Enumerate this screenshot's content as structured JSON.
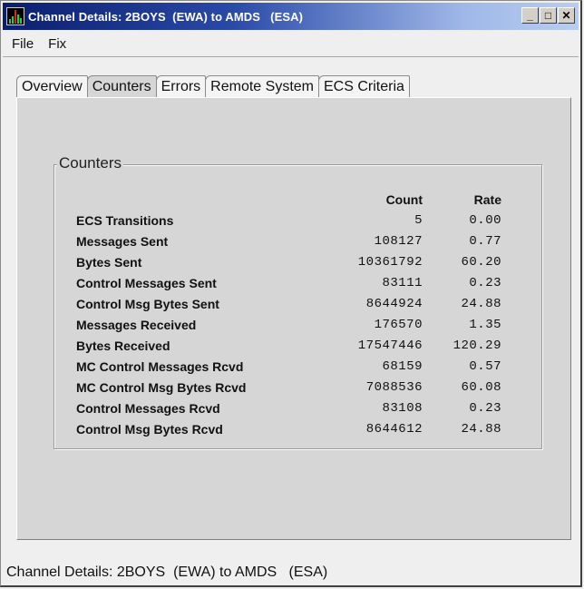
{
  "window": {
    "title": "Channel Details: 2BOYS  (EWA) to AMDS   (ESA)",
    "app_icon": "bar-graph-icon",
    "controls": {
      "minimize": "_",
      "maximize": "□",
      "close": "✕"
    }
  },
  "menubar": {
    "items": [
      {
        "label": "File"
      },
      {
        "label": "Fix"
      }
    ]
  },
  "tabs": [
    {
      "label": "Overview",
      "active": false
    },
    {
      "label": "Counters",
      "active": true
    },
    {
      "label": "Errors",
      "active": false
    },
    {
      "label": "Remote System",
      "active": false
    },
    {
      "label": "ECS Criteria",
      "active": false
    }
  ],
  "counters": {
    "group_title": "Counters",
    "headers": {
      "count": "Count",
      "rate": "Rate"
    },
    "rows": [
      {
        "label": "ECS Transitions",
        "count": "5",
        "rate": "0.00"
      },
      {
        "label": "Messages Sent",
        "count": "108127",
        "rate": "0.77"
      },
      {
        "label": "Bytes Sent",
        "count": "10361792",
        "rate": "60.20"
      },
      {
        "label": "Control Messages Sent",
        "count": "83111",
        "rate": "0.23"
      },
      {
        "label": "Control Msg Bytes Sent",
        "count": "8644924",
        "rate": "24.88"
      },
      {
        "label": "Messages Received",
        "count": "176570",
        "rate": "1.35"
      },
      {
        "label": "Bytes Received",
        "count": "17547446",
        "rate": "120.29"
      },
      {
        "label": "MC Control Messages Rcvd",
        "count": "68159",
        "rate": "0.57"
      },
      {
        "label": "MC Control Msg Bytes Rcvd",
        "count": "7088536",
        "rate": "60.08"
      },
      {
        "label": "Control Messages Rcvd",
        "count": "83108",
        "rate": "0.23"
      },
      {
        "label": "Control Msg Bytes Rcvd",
        "count": "8644612",
        "rate": "24.88"
      }
    ]
  },
  "status_bar": {
    "text": "Channel Details: 2BOYS  (EWA) to AMDS   (ESA)"
  }
}
